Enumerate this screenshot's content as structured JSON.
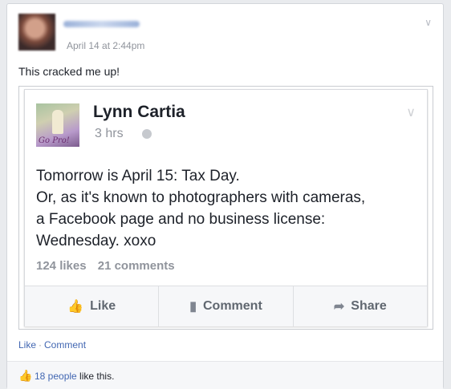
{
  "post": {
    "timestamp": "April 14 at 2:44pm",
    "text": "This cracked me up!"
  },
  "shared": {
    "author": "Lynn Cartia",
    "relative_time": "3 hrs",
    "avatar_caption": "Go Pro!",
    "status_lines": [
      "Tomorrow is April 15: Tax Day.",
      "Or, as it's known to photographers with cameras,",
      "a Facebook page and no business license:",
      "Wednesday. xoxo"
    ],
    "likes": "124 likes",
    "comments": "21 comments",
    "actions": {
      "like": "Like",
      "comment": "Comment",
      "share": "Share"
    }
  },
  "footer": {
    "like": "Like",
    "comment": "Comment",
    "people_link": "18 people",
    "people_suffix": " like this."
  },
  "icons": {
    "chevron": "chevron-down-icon",
    "globe": "globe-icon",
    "thumb": "thumbs-up-icon"
  },
  "colors": {
    "link": "#4267b2",
    "muted": "#90949c"
  }
}
